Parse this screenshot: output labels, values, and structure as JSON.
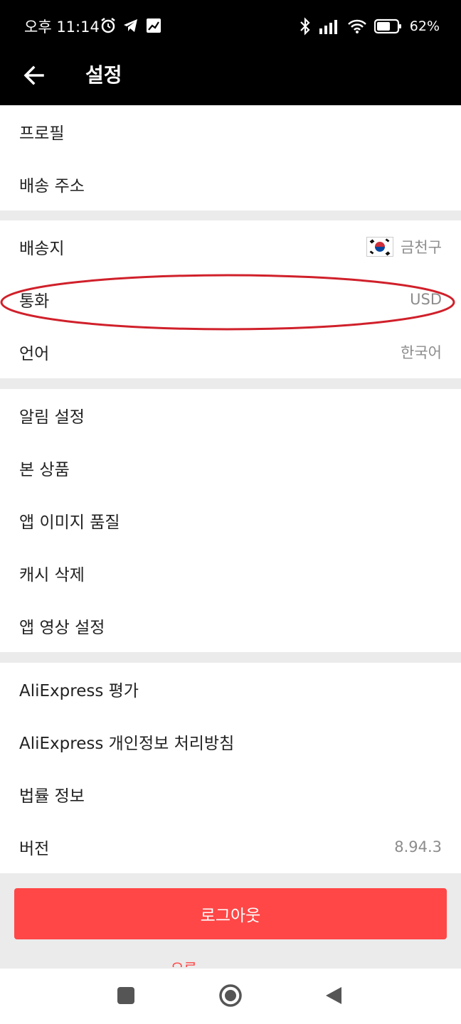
{
  "status_bar": {
    "time": "오후 11:14",
    "battery": "62%",
    "icons_left": [
      "alarm-icon",
      "telegram-icon",
      "chart-app-icon"
    ],
    "icons_right": [
      "bluetooth-icon",
      "signal-icon",
      "wifi-icon",
      "battery-icon"
    ]
  },
  "header": {
    "title": "설정",
    "back_icon": "arrow-left-icon"
  },
  "sections": {
    "account": {
      "profile": "프로필",
      "shipping_address": "배송 주소"
    },
    "region": {
      "ship_to_label": "배송지",
      "ship_to_value": "금천구",
      "ship_to_flag": "korea-flag-icon",
      "currency_label": "통화",
      "currency_value": "USD",
      "language_label": "언어",
      "language_value": "한국어"
    },
    "app": {
      "notifications": "알림 설정",
      "viewed_items": "본 상품",
      "image_quality": "앱 이미지 품질",
      "clear_cache": "캐시 삭제",
      "video_settings": "앱 영상 설정"
    },
    "about": {
      "rate": "AliExpress 평가",
      "privacy": "AliExpress 개인정보 처리방침",
      "legal": "법률 정보",
      "version_label": "버전",
      "version_value": "8.94.3"
    }
  },
  "logout_label": "로그아웃",
  "peek_text": "오류",
  "nav": [
    "recents-square-icon",
    "home-circle-icon",
    "back-triangle-icon"
  ],
  "colors": {
    "accent": "#ff4747",
    "highlight_ellipse": "#d0202a",
    "header_bg": "#000000",
    "divider": "#ebebeb"
  }
}
